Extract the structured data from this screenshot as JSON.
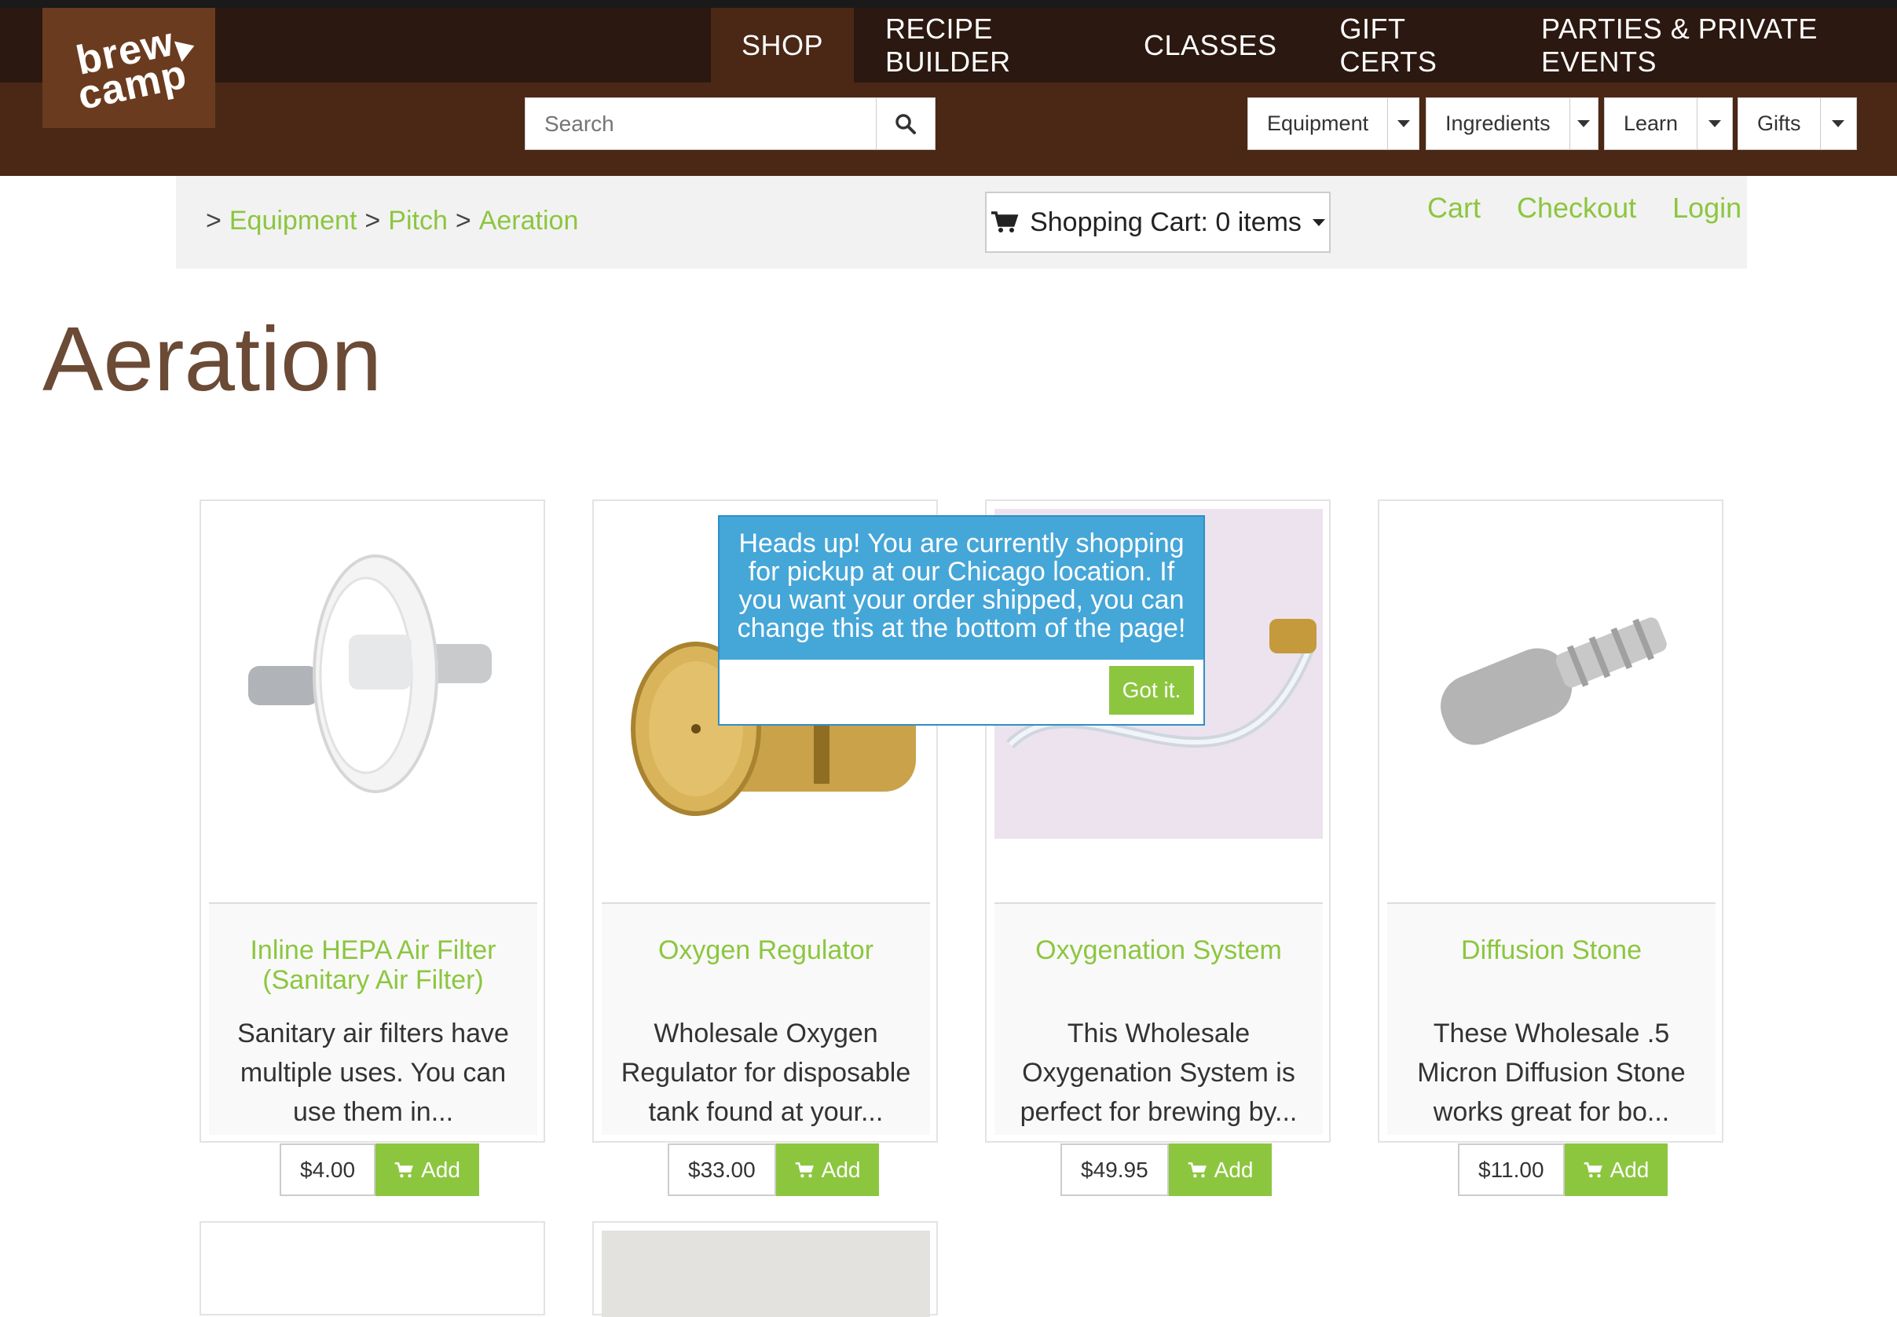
{
  "nav": {
    "items": [
      {
        "label": "SHOP"
      },
      {
        "label": "RECIPE BUILDER"
      },
      {
        "label": "CLASSES"
      },
      {
        "label": "GIFT CERTS"
      },
      {
        "label": "PARTIES & PRIVATE EVENTS"
      }
    ]
  },
  "logo": {
    "line1": "brew",
    "line2": "camp"
  },
  "search": {
    "placeholder": "Search"
  },
  "dropdowns": [
    {
      "label": "Equipment"
    },
    {
      "label": "Ingredients"
    },
    {
      "label": "Learn"
    },
    {
      "label": "Gifts"
    }
  ],
  "breadcrumb": {
    "prefix1": ">",
    "item1": "Equipment",
    "prefix2": ">",
    "item2": "Pitch",
    "prefix3": ">",
    "item3": "Aeration"
  },
  "cart": {
    "label": "Shopping Cart: 0 items"
  },
  "top_links": {
    "cart": "Cart",
    "checkout": "Checkout",
    "login": "Login"
  },
  "page": {
    "title": "Aeration"
  },
  "products": [
    {
      "name": "Inline HEPA Air Filter (Sanitary Air Filter)",
      "desc": "Sanitary air filters have multiple uses. You can use them in...",
      "price": "$4.00",
      "add": "Add"
    },
    {
      "name": "Oxygen Regulator",
      "desc": "Wholesale Oxygen Regulator for disposable tank found at your...",
      "price": "$33.00",
      "add": "Add"
    },
    {
      "name": "Oxygenation System",
      "desc": "This Wholesale Oxygenation System is perfect for brewing by...",
      "price": "$49.95",
      "add": "Add"
    },
    {
      "name": "Diffusion Stone",
      "desc": "These Wholesale .5 Micron Diffusion Stone works great for bo...",
      "price": "$11.00",
      "add": "Add"
    }
  ],
  "popup": {
    "message": "Heads up! You are currently shopping for pickup at our Chicago location. If you want your order shipped, you can change this at the bottom of the page!",
    "button": "Got it."
  },
  "colors": {
    "accent_green": "#8cc63f",
    "header_dark": "#2b1810",
    "header_brown": "#4a2815",
    "title_brown": "#6b4a36",
    "popup_blue": "#45a6d8"
  }
}
